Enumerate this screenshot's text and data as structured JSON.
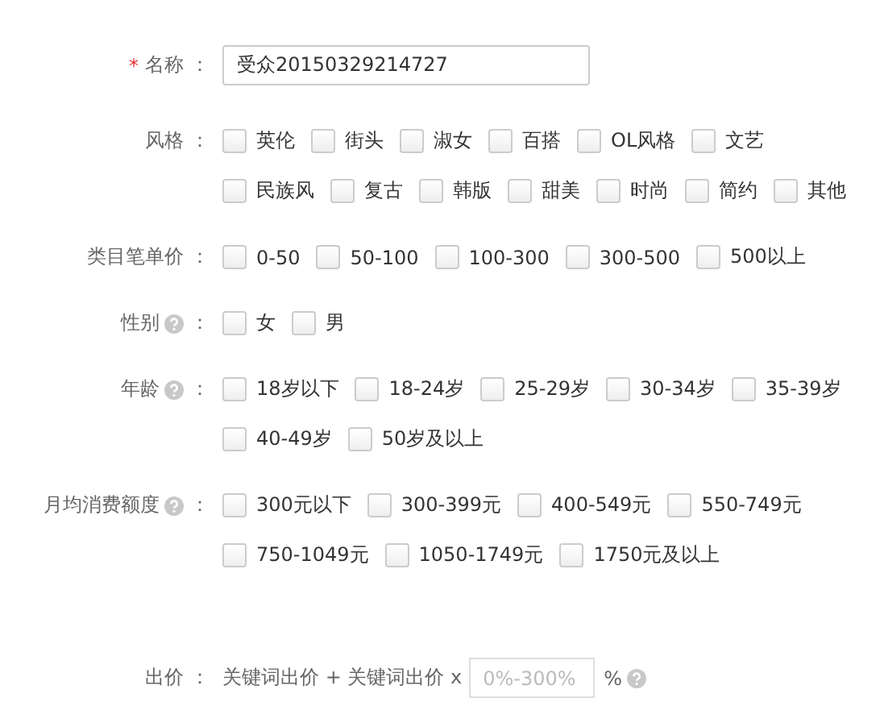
{
  "fields": [
    {
      "kind": "text",
      "required_mark": "*",
      "label": "名称",
      "colon": "：",
      "value": "受众20150329214727"
    },
    {
      "kind": "checkboxes",
      "label": "风格",
      "colon": "：",
      "rows": [
        [
          {
            "label": "英伦",
            "checked": false
          },
          {
            "label": "街头",
            "checked": false
          },
          {
            "label": "淑女",
            "checked": false
          },
          {
            "label": "百搭",
            "checked": false
          },
          {
            "label": "OL风格",
            "checked": false
          },
          {
            "label": "文艺",
            "checked": false
          }
        ],
        [
          {
            "label": "民族风",
            "checked": false
          },
          {
            "label": "复古",
            "checked": false
          },
          {
            "label": "韩版",
            "checked": false
          },
          {
            "label": "甜美",
            "checked": false
          },
          {
            "label": "时尚",
            "checked": false
          },
          {
            "label": "简约",
            "checked": false
          },
          {
            "label": "其他",
            "checked": false
          }
        ]
      ]
    },
    {
      "kind": "checkboxes",
      "label": "类目笔单价",
      "colon": "：",
      "rows": [
        [
          {
            "label": "0-50",
            "checked": false
          },
          {
            "label": "50-100",
            "checked": false
          },
          {
            "label": "100-300",
            "checked": false
          },
          {
            "label": "300-500",
            "checked": false
          },
          {
            "label": "500以上",
            "checked": false
          }
        ]
      ]
    },
    {
      "kind": "checkboxes",
      "label": "性别",
      "help": true,
      "colon": "：",
      "rows": [
        [
          {
            "label": "女",
            "checked": false
          },
          {
            "label": "男",
            "checked": false
          }
        ]
      ]
    },
    {
      "kind": "checkboxes",
      "label": "年龄",
      "help": true,
      "colon": "：",
      "rows": [
        [
          {
            "label": "18岁以下",
            "checked": false
          },
          {
            "label": "18-24岁",
            "checked": false
          },
          {
            "label": "25-29岁",
            "checked": false
          },
          {
            "label": "30-34岁",
            "checked": false
          },
          {
            "label": "35-39岁",
            "checked": false
          }
        ],
        [
          {
            "label": "40-49岁",
            "checked": false
          },
          {
            "label": "50岁及以上",
            "checked": false
          }
        ]
      ]
    },
    {
      "kind": "checkboxes",
      "label": "月均消费额度",
      "help": true,
      "colon": "：",
      "rows": [
        [
          {
            "label": "300元以下",
            "checked": false
          },
          {
            "label": "300-399元",
            "checked": false
          },
          {
            "label": "400-549元",
            "checked": false
          },
          {
            "label": "550-749元",
            "checked": false
          }
        ],
        [
          {
            "label": "750-1049元",
            "checked": false
          },
          {
            "label": "1050-1749元",
            "checked": false
          },
          {
            "label": "1750元及以上",
            "checked": false
          }
        ]
      ]
    },
    {
      "kind": "bid",
      "label": "出价",
      "colon": "：",
      "formula": "关键词出价 + 关键词出价 x",
      "placeholder": "0%-300%",
      "unit": "%",
      "unit_help": true
    }
  ]
}
